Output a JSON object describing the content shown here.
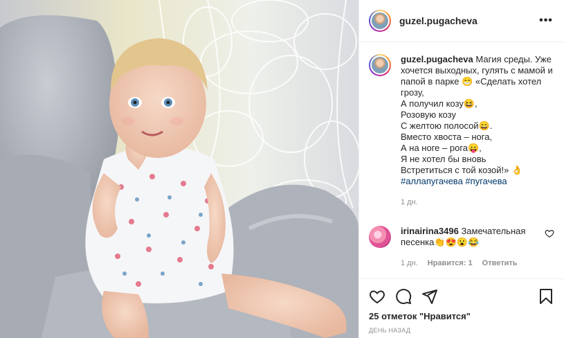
{
  "post": {
    "username": "guzel.pugacheva",
    "more_label": "•••"
  },
  "caption": {
    "username": "guzel.pugacheva",
    "lines": [
      "Магия среды. Уже хочется выходных, гулять с мамой и папой в парке 😁 «Сделать хотел грозу,",
      "А получил козу😆,",
      "Розовую козу",
      "С желтою полосой😄.",
      "Вместо хвоста – нога,",
      "А на ноге – рога😛,",
      "Я не хотел бы вновь",
      "Встретиться с той козой!» 👌"
    ],
    "hashtags": [
      "#аллапугачева",
      "#пугачева"
    ],
    "time": "1 дн."
  },
  "comment": {
    "username": "irinairina3496",
    "text": "Замечательная песенка👏😍😮😂",
    "time": "1 дн.",
    "likes": "Нравится: 1",
    "reply": "Ответить"
  },
  "footer": {
    "likes": "25 отметок \"Нравится\"",
    "time_ago": "ДЕНЬ НАЗАД"
  },
  "icons": {
    "like": "heart-icon",
    "comment": "comment-icon",
    "share": "paper-plane-icon",
    "save": "bookmark-icon"
  },
  "colors": {
    "text": "#262626",
    "muted": "#8e8e8e",
    "link": "#00376b",
    "border": "#efefef"
  }
}
